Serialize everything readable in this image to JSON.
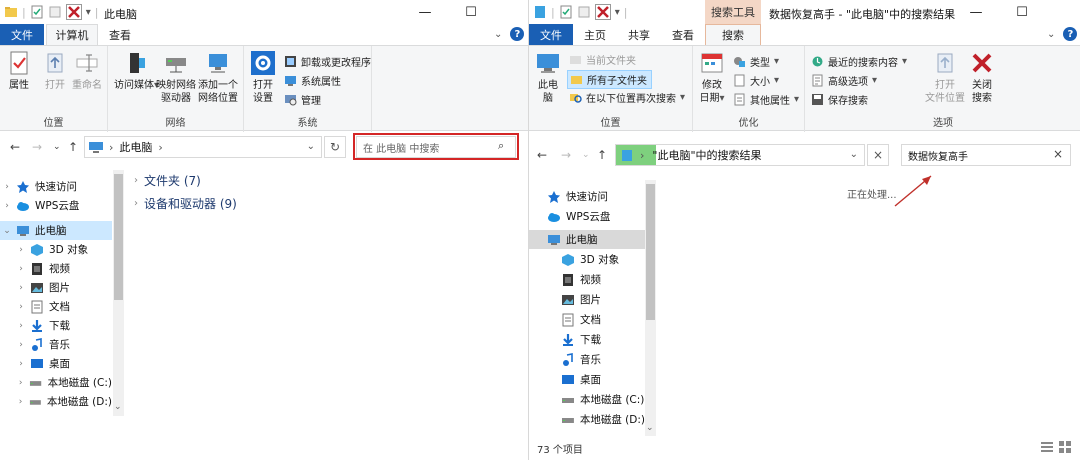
{
  "left": {
    "title": "此电脑",
    "tabs": {
      "file": "文件",
      "computer": "计算机",
      "view": "查看"
    },
    "ribbon": {
      "position": {
        "label": "位置",
        "properties": "属性",
        "open": "打开",
        "rename": "重命名"
      },
      "network": {
        "label": "网络",
        "access_media": "访问媒体",
        "map_drive_1": "映射网络",
        "map_drive_2": "驱动器",
        "add_location_1": "添加一个",
        "add_location_2": "网络位置"
      },
      "system": {
        "label": "系统",
        "open_settings_1": "打开",
        "open_settings_2": "设置",
        "uninstall": "卸载或更改程序",
        "sys_props": "系统属性",
        "manage": "管理"
      }
    },
    "address": {
      "path": "此电脑",
      "sep": "›"
    },
    "search": {
      "placeholder": "在 此电脑 中搜索"
    },
    "nav": [
      "快速访问",
      "WPS云盘",
      "此电脑",
      "3D 对象",
      "视频",
      "图片",
      "文档",
      "下载",
      "音乐",
      "桌面",
      "本地磁盘 (C:)",
      "本地磁盘 (D:)"
    ],
    "content": {
      "folders": "文件夹 (7)",
      "devices": "设备和驱动器 (9)"
    }
  },
  "right": {
    "title": "数据恢复高手 - \"此电脑\"中的搜索结果",
    "tabs": {
      "context": "搜索工具",
      "file": "文件",
      "home": "主页",
      "share": "共享",
      "view": "查看",
      "search": "搜索"
    },
    "ribbon": {
      "location": {
        "label": "位置",
        "this_pc_1": "此电",
        "this_pc_2": "脑",
        "current_folder": "当前文件夹",
        "all_subfolders": "所有子文件夹",
        "search_again": "在以下位置再次搜索"
      },
      "refine": {
        "label": "优化",
        "date_1": "修改",
        "date_2": "日期",
        "type": "类型",
        "size": "大小",
        "other_props": "其他属性"
      },
      "options": {
        "label": "选项",
        "recent": "最近的搜索内容",
        "advanced": "高级选项",
        "save": "保存搜索",
        "open_loc_1": "打开",
        "open_loc_2": "文件位置",
        "close_1": "关闭",
        "close_2": "搜索"
      }
    },
    "address": {
      "path": "\"此电脑\"中的搜索结果"
    },
    "search": {
      "value": "数据恢复高手"
    },
    "processing": "正在处理...",
    "nav": [
      "快速访问",
      "WPS云盘",
      "此电脑",
      "3D 对象",
      "视频",
      "图片",
      "文档",
      "下载",
      "音乐",
      "桌面",
      "本地磁盘 (C:)",
      "本地磁盘 (D:)"
    ],
    "status": "73 个项目"
  },
  "icons": {
    "back": "←",
    "forward": "→",
    "dropdown": "⌄",
    "up": "↑",
    "refresh": "↻",
    "close": "×",
    "search": "⌕",
    "minimize": "—",
    "maximize": "☐",
    "expand": "›",
    "collapse": "⌄",
    "small_drop": "▾",
    "up_arrow": "⌃"
  },
  "colors": {
    "accent": "#1a5fb4",
    "highlight_red": "#d42626",
    "context_tab": "#f4d7c6",
    "address_green": "#7ed07e"
  }
}
